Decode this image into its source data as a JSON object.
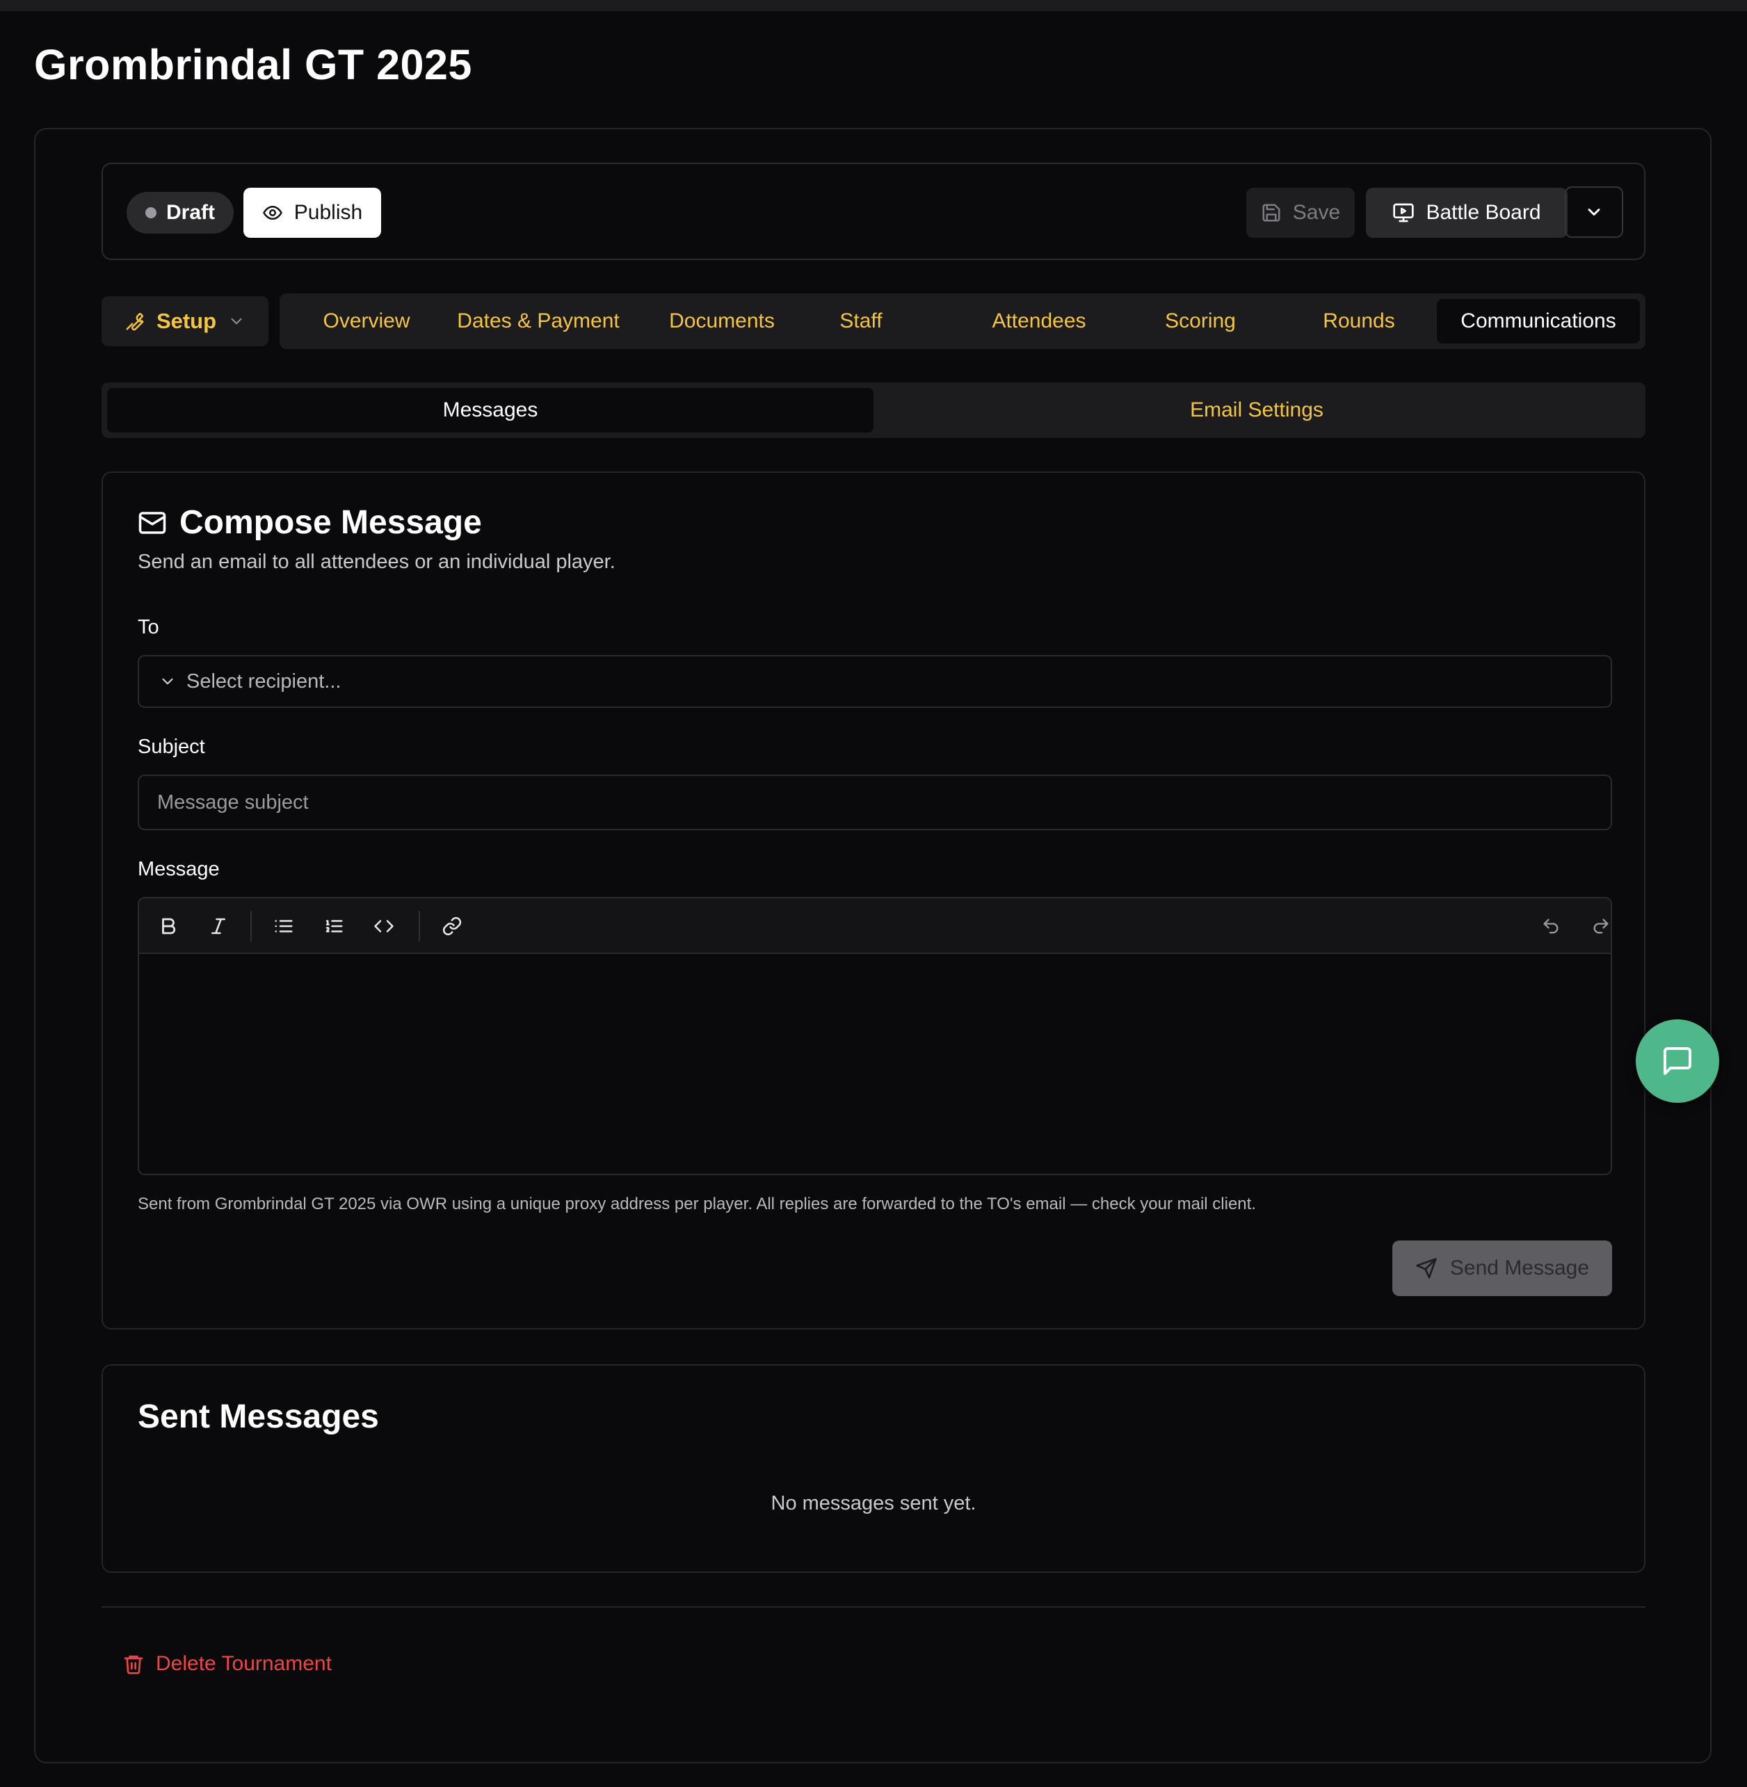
{
  "page": {
    "title": "Grombrindal GT 2025"
  },
  "action_bar": {
    "status": "Draft",
    "publish_label": "Publish",
    "save_label": "Save",
    "battle_board_label": "Battle Board"
  },
  "nav": {
    "setup_label": "Setup",
    "tabs": [
      {
        "label": "Overview"
      },
      {
        "label": "Dates & Payment"
      },
      {
        "label": "Documents"
      },
      {
        "label": "Staff"
      },
      {
        "label": "Attendees"
      },
      {
        "label": "Scoring"
      },
      {
        "label": "Rounds"
      },
      {
        "label": "Communications",
        "active": true
      }
    ]
  },
  "subtabs": [
    {
      "label": "Messages",
      "active": true
    },
    {
      "label": "Email Settings"
    }
  ],
  "compose": {
    "title": "Compose Message",
    "subtitle": "Send an email to all attendees or an individual player.",
    "to_label": "To",
    "to_placeholder": "Select recipient...",
    "subject_label": "Subject",
    "subject_placeholder": "Message subject",
    "message_label": "Message",
    "toolbar_icons": [
      "bold-icon",
      "italic-icon",
      "bullet-list-icon",
      "ordered-list-icon",
      "code-icon",
      "link-icon",
      "undo-icon",
      "redo-icon"
    ],
    "footnote": "Sent from Grombrindal GT 2025 via OWR using a unique proxy address per player. All replies are forwarded to the TO's email — check your mail client.",
    "send_label": "Send Message"
  },
  "sent": {
    "title": "Sent Messages",
    "empty_text": "No messages sent yet."
  },
  "danger": {
    "delete_label": "Delete Tournament"
  },
  "colors": {
    "background": "#0a0a0c",
    "accent_yellow": "#f5c542",
    "danger_red": "#ef4444",
    "chat_green": "#4fb88a"
  }
}
